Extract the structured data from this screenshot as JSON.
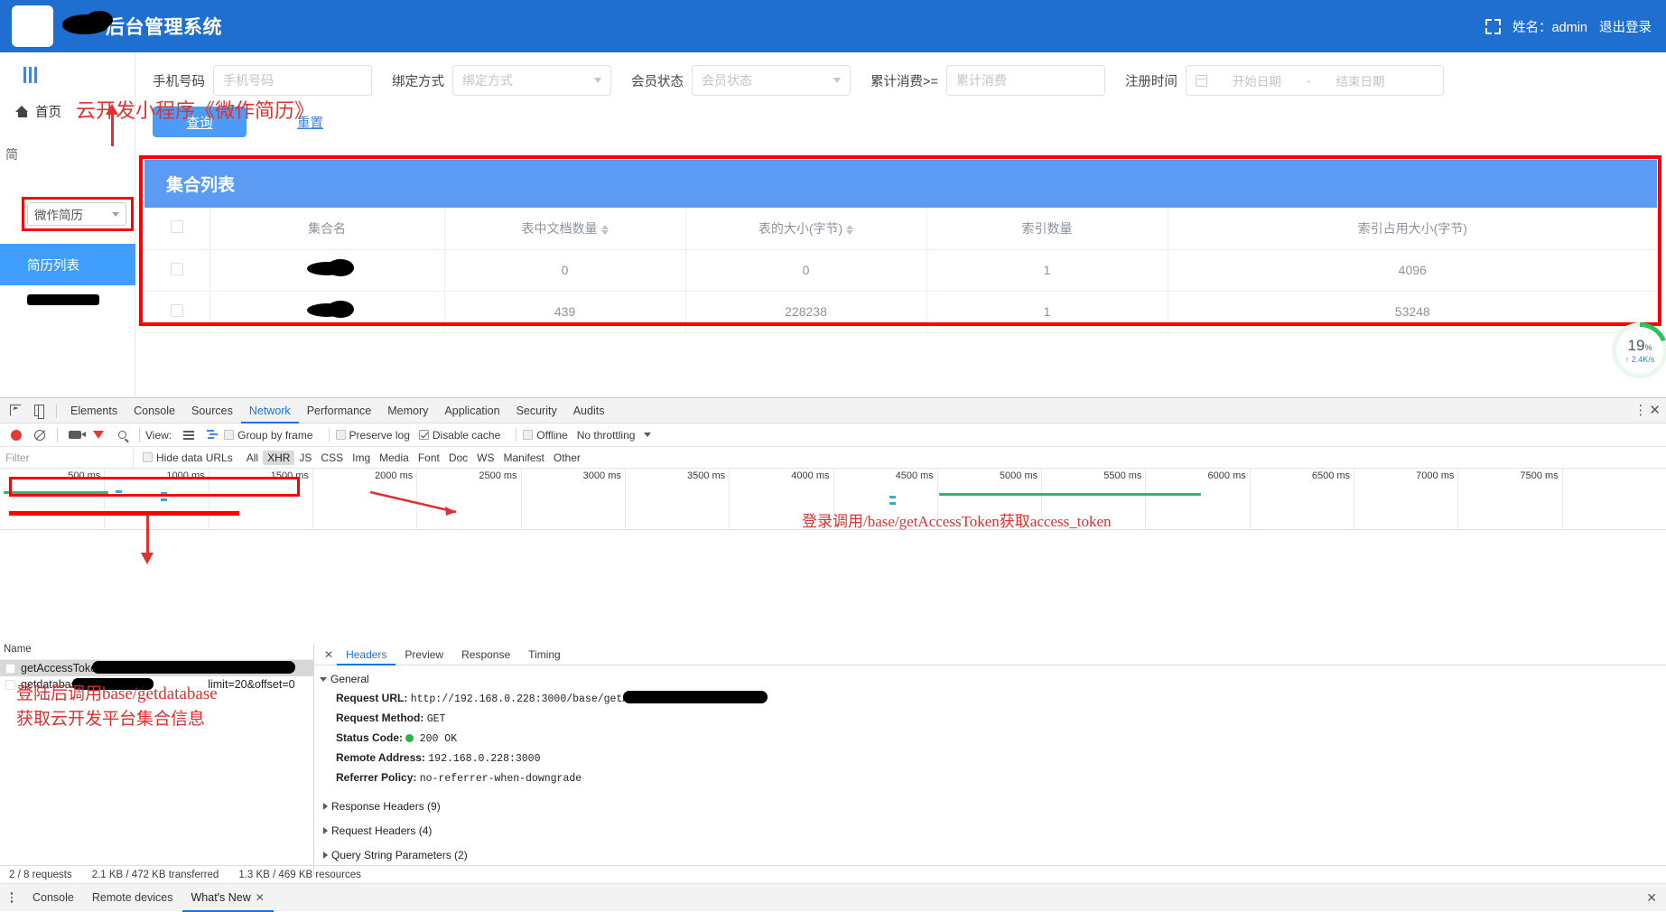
{
  "app": {
    "header": {
      "brand": "后台管理系统",
      "fullscreen_icon": "fullscreen-icon",
      "user_label": "姓名：admin",
      "logout": "退出登录"
    },
    "sidebar": {
      "collapse_icon": "collapse-icon",
      "home": "首页",
      "project_select_value": "微作简历",
      "menu_label": "简",
      "active_item": "简历列表"
    },
    "filters": {
      "phone_label": "手机号码",
      "phone_placeholder": "手机号码",
      "bind_label": "绑定方式",
      "bind_placeholder": "绑定方式",
      "member_label": "会员状态",
      "member_placeholder": "会员状态",
      "spend_label": "累计消费>=",
      "spend_placeholder": "累计消费",
      "reg_label": "注册时间",
      "date_start_placeholder": "开始日期",
      "date_sep": "-",
      "date_end_placeholder": "结束日期",
      "query_button": "查询",
      "reset_button": "重置"
    },
    "card": {
      "title": "集合列表",
      "columns": [
        "",
        "集合名",
        "表中文档数量",
        "表的大小(字节)",
        "索引数量",
        "索引占用大小(字节)"
      ],
      "rows": [
        {
          "name": "",
          "docs": "0",
          "size": "0",
          "indexes": "1",
          "index_size": "4096"
        },
        {
          "name": "",
          "docs": "439",
          "size": "228238",
          "indexes": "1",
          "index_size": "53248"
        }
      ]
    },
    "perf_widget": {
      "percent": "19",
      "percent_unit": "%",
      "rate": "↑ 2.4K/s"
    },
    "annotation_top": "云开发小程序《微作简历》"
  },
  "devtools": {
    "tabs": [
      "Elements",
      "Console",
      "Sources",
      "Network",
      "Performance",
      "Memory",
      "Application",
      "Security",
      "Audits"
    ],
    "active_tab": "Network",
    "toolbar": {
      "view_label": "View:",
      "group_by_frame": "Group by frame",
      "preserve_log": "Preserve log",
      "disable_cache": "Disable cache",
      "offline": "Offline",
      "throttling": "No throttling"
    },
    "filterbar": {
      "filter_placeholder": "Filter",
      "hide_data_urls": "Hide data URLs",
      "types": [
        "All",
        "XHR",
        "JS",
        "CSS",
        "Img",
        "Media",
        "Font",
        "Doc",
        "WS",
        "Manifest",
        "Other"
      ],
      "selected_type": "XHR"
    },
    "timeline": {
      "ticks": [
        "500 ms",
        "1000 ms",
        "1500 ms",
        "2000 ms",
        "2500 ms",
        "3000 ms",
        "3500 ms",
        "4000 ms",
        "4500 ms",
        "5000 ms",
        "5500 ms",
        "6000 ms",
        "6500 ms",
        "7000 ms",
        "7500 ms"
      ]
    },
    "requests": {
      "column": "Name",
      "rows": [
        {
          "name": "getAccessToken?",
          "selected": true
        },
        {
          "name": "getdatabase?env=",
          "suffix": "limit=20&offset=0",
          "selected": false
        }
      ]
    },
    "detail": {
      "tabs": [
        "Headers",
        "Preview",
        "Response",
        "Timing"
      ],
      "active_tab": "Headers",
      "general_title": "General",
      "fields": [
        {
          "key": "Request URL:",
          "value": "http://192.168.0.228:3000/base/getAccessToken?"
        },
        {
          "key": "Request Method:",
          "value": "GET"
        },
        {
          "key": "Status Code:",
          "value": "200  OK"
        },
        {
          "key": "Remote Address:",
          "value": "192.168.0.228:3000"
        },
        {
          "key": "Referrer Policy:",
          "value": "no-referrer-when-downgrade"
        }
      ],
      "sections": [
        "Response Headers (9)",
        "Request Headers (4)",
        "Query String Parameters (2)"
      ]
    },
    "status": {
      "requests": "2 / 8 requests",
      "transferred": "2.1 KB / 472 KB transferred",
      "resources": "1.3 KB / 469 KB resources"
    },
    "drawer": {
      "tabs": [
        "Console",
        "Remote devices",
        "What's New"
      ],
      "active_tab": "What's New"
    }
  },
  "annotations": {
    "login_token": "登录调用/base/getAccessToken获取access_token",
    "database_line1": "登陆后调用base/getdatabase",
    "database_line2": "获取云开发平台集合信息"
  },
  "colors": {
    "brand_blue": "#1f6fd0",
    "card_blue": "#5b9bf3",
    "accent": "#409eff",
    "annotation_red": "#e03030",
    "status_green": "#2fb344"
  }
}
